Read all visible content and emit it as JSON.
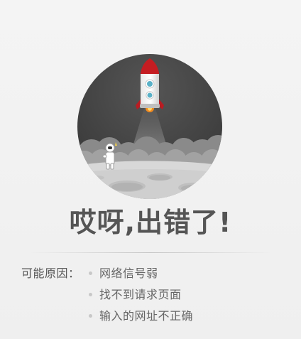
{
  "error": {
    "headline": "哎呀,出错了!",
    "reasons_label": "可能原因：",
    "reasons": [
      "网络信号弱",
      "找不到请求页面",
      "输入的网址不正确"
    ]
  },
  "icons": {
    "hero": "rocket-launch-illustration",
    "astronaut": "astronaut-icon",
    "bullet": "bullet-dot-icon"
  },
  "colors": {
    "background": "#f2f2f2",
    "headline": "#555555",
    "text": "#666666",
    "bullet": "#c8c8c8",
    "rocket_red": "#c51d22"
  }
}
